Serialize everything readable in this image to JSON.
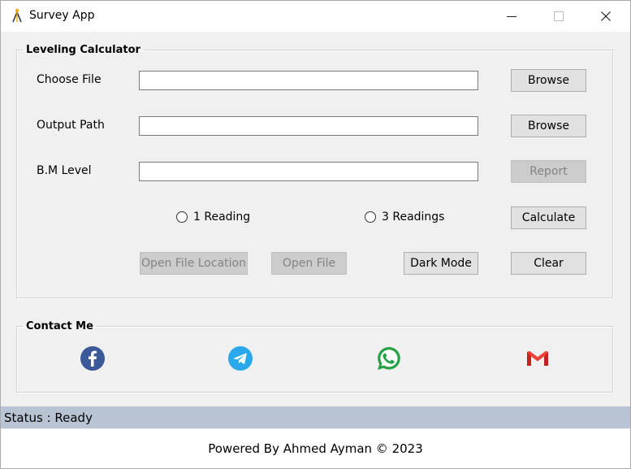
{
  "window": {
    "title": "Survey App",
    "icon": "surveyor-tripod-icon"
  },
  "leveling": {
    "legend": "Leveling Calculator",
    "choose_file_label": "Choose File",
    "choose_file_value": "",
    "output_path_label": "Output Path",
    "output_path_value": "",
    "bm_level_label": "B.M Level",
    "bm_level_value": "",
    "browse_label_1": "Browse",
    "browse_label_2": "Browse",
    "report_label": "Report",
    "radio_1_label": "1 Reading",
    "radio_3_label": "3 Readings",
    "calculate_label": "Calculate",
    "open_location_label": "Open File Location",
    "open_file_label": "Open File",
    "dark_mode_label": "Dark Mode",
    "clear_label": "Clear"
  },
  "contact": {
    "legend": "Contact Me",
    "icons": [
      "facebook-icon",
      "telegram-icon",
      "whatsapp-icon",
      "gmail-icon"
    ]
  },
  "status": {
    "text": "Status : Ready"
  },
  "footer": {
    "text": "Powered By Ahmed Ayman © 2023"
  },
  "colors": {
    "facebook": "#3b5998",
    "telegram": "#29a9eb",
    "whatsapp": "#25a244",
    "gmail_red": "#ea4335",
    "statusbar": "#b8c4d4"
  }
}
